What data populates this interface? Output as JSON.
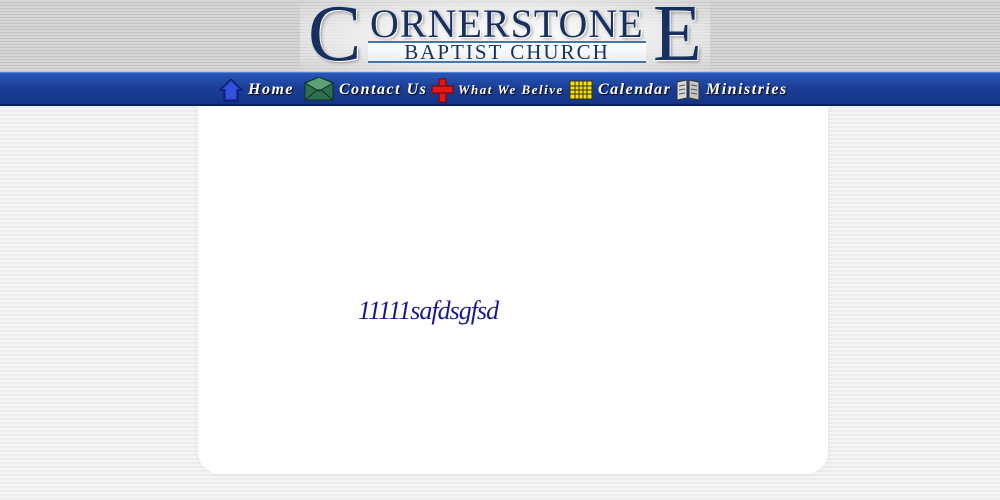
{
  "header": {
    "logo": {
      "first_letter": "C",
      "title_middle": "ORNERSTONE",
      "last_letter": "E",
      "subtitle": "BAPTIST CHURCH"
    }
  },
  "nav": {
    "items": [
      {
        "label": "Home",
        "icon": "home-icon"
      },
      {
        "label": "Contact Us",
        "icon": "envelope-icon"
      },
      {
        "label": "What We Belive",
        "icon": "red-cross-icon"
      },
      {
        "label": "Calendar",
        "icon": "calendar-icon"
      },
      {
        "label": "Ministries",
        "icon": "book-icon"
      }
    ]
  },
  "main": {
    "body_text": "11111safdsgfsd"
  },
  "colors": {
    "nav_blue": "#1b3f98",
    "logo_navy": "#17305f",
    "body_text": "#1a1a8c"
  }
}
